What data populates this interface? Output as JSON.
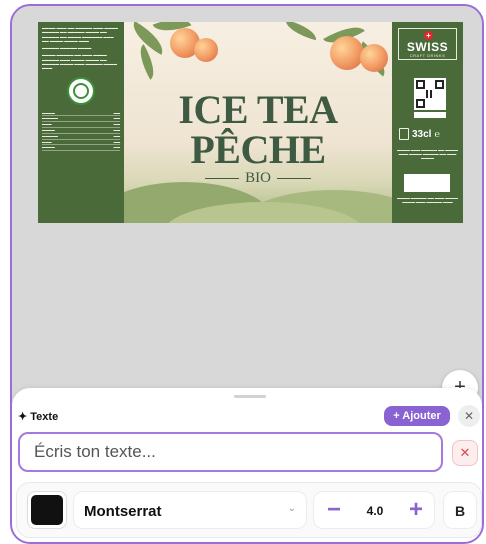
{
  "label": {
    "title_line1": "ICE TEA",
    "title_line2": "PÊCHE",
    "subtitle": "BIO",
    "brand": "SWISS",
    "brand_sub": "CRAFT DRINKS",
    "volume": "33cl",
    "ce_mark": "℮"
  },
  "sheet": {
    "title": "✦ Texte",
    "add_label": "+ Ajouter",
    "close_label": "✕",
    "input_placeholder": "Écris ton texte...",
    "clear_label": "✕"
  },
  "toolbar": {
    "color": "#111111",
    "font_name": "Montserrat",
    "chevron": "⌄",
    "minus_label": "−",
    "size_value": "4.0",
    "plus_label": "+",
    "bold_label": "B"
  },
  "fab_label": "+",
  "colors": {
    "accent": "#8a63d2",
    "frame": "#9b6cdb",
    "label_green": "#4a6a3a",
    "title_green": "#3f5a42"
  }
}
